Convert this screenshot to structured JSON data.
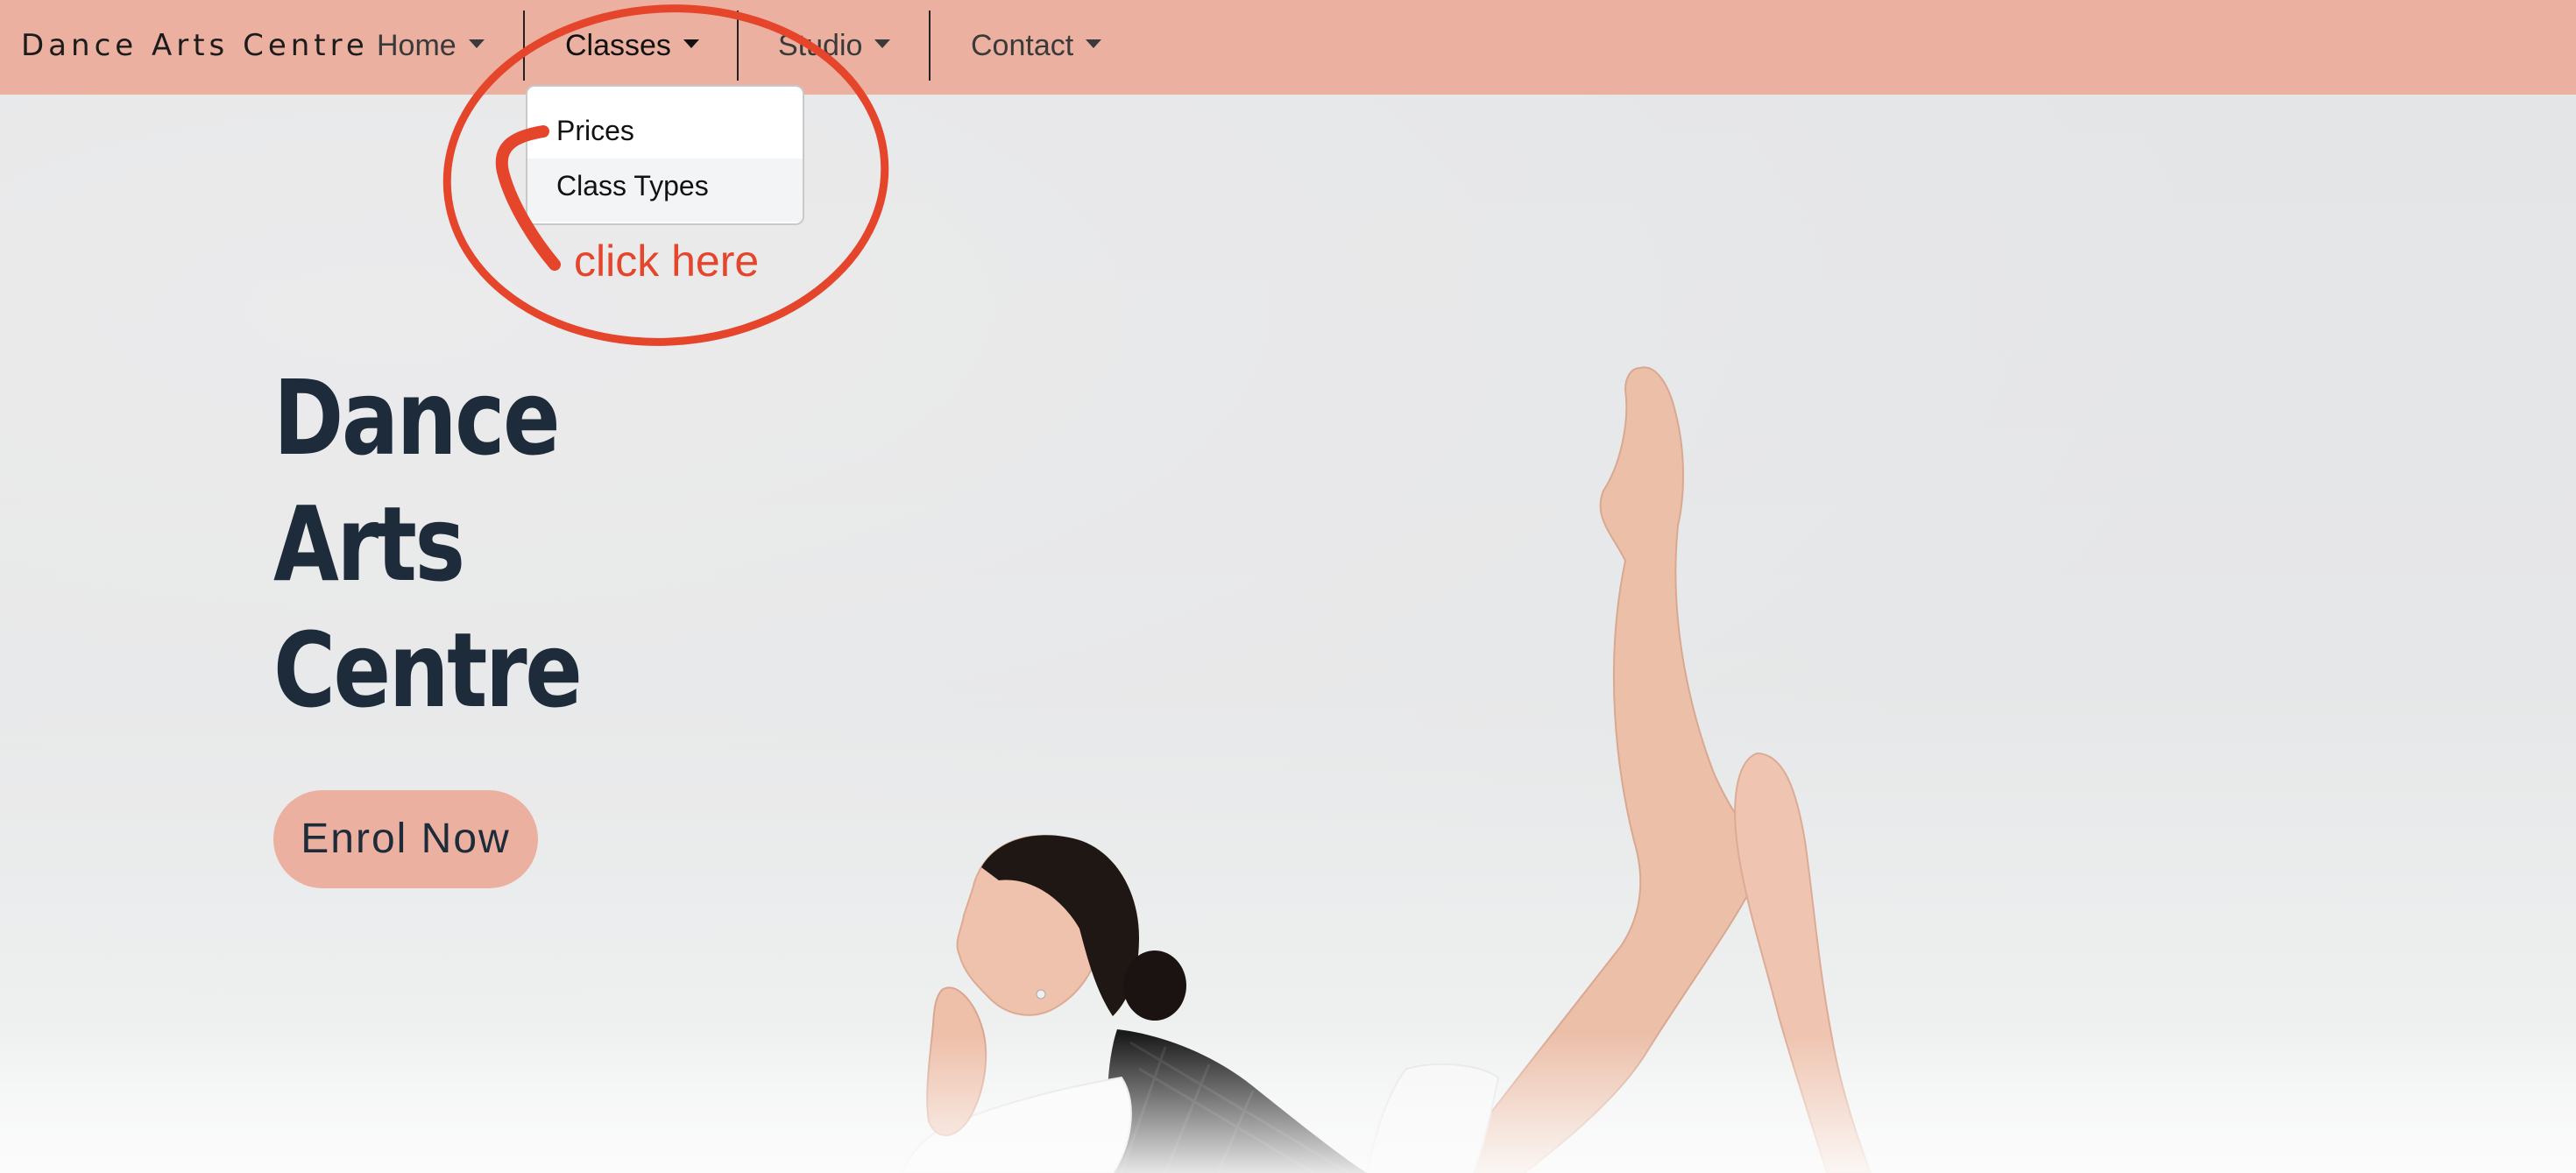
{
  "navbar": {
    "brand": "Dance Arts Centre",
    "items": [
      {
        "label": "Home"
      },
      {
        "label": "Classes"
      },
      {
        "label": "Studio"
      },
      {
        "label": "Contact"
      }
    ],
    "active_item": "Classes",
    "background": "#ebb09f"
  },
  "dropdown": {
    "items": [
      {
        "label": "Prices"
      },
      {
        "label": "Class Types"
      }
    ]
  },
  "annotation": {
    "text": "click here",
    "color": "#e5452b"
  },
  "hero": {
    "title_lines": [
      "Dance",
      "Arts",
      "Centre"
    ],
    "cta_label": "Enrol Now",
    "title_color": "#1d2b3a"
  },
  "icons": {
    "caret": "chevron-down-icon"
  }
}
